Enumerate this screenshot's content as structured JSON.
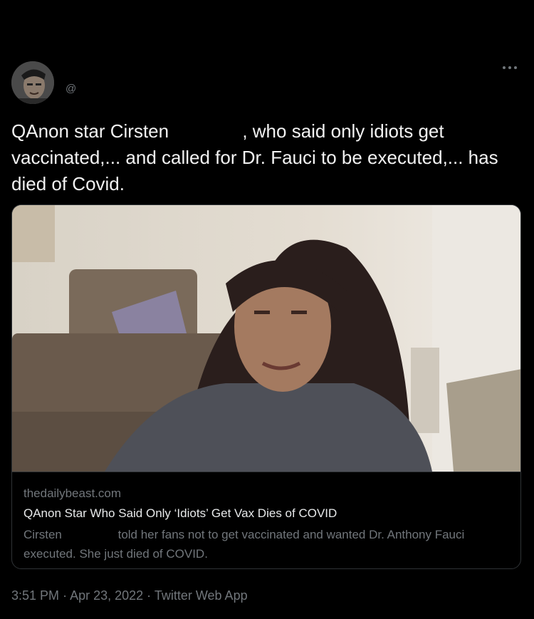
{
  "tweet": {
    "handle": "@",
    "text_part1": "QAnon star Cirsten",
    "text_part2": ", who said only idiots get vaccinated,... and called for Dr. Fauci to be executed,... has died of Covid.",
    "card": {
      "domain": "thedailybeast.com",
      "headline": "QAnon Star Who Said Only ‘Idiots’ Get Vax Dies of COVID",
      "desc_part1": "Cirsten",
      "desc_part2": "told her fans not to get vaccinated and wanted Dr. Anthony Fauci executed. She just died of COVID."
    },
    "time": "3:51 PM",
    "separator": "·",
    "date": "Apr 23, 2022",
    "source": "Twitter Web App"
  },
  "icons": {
    "more": "more-horizontal-icon"
  }
}
